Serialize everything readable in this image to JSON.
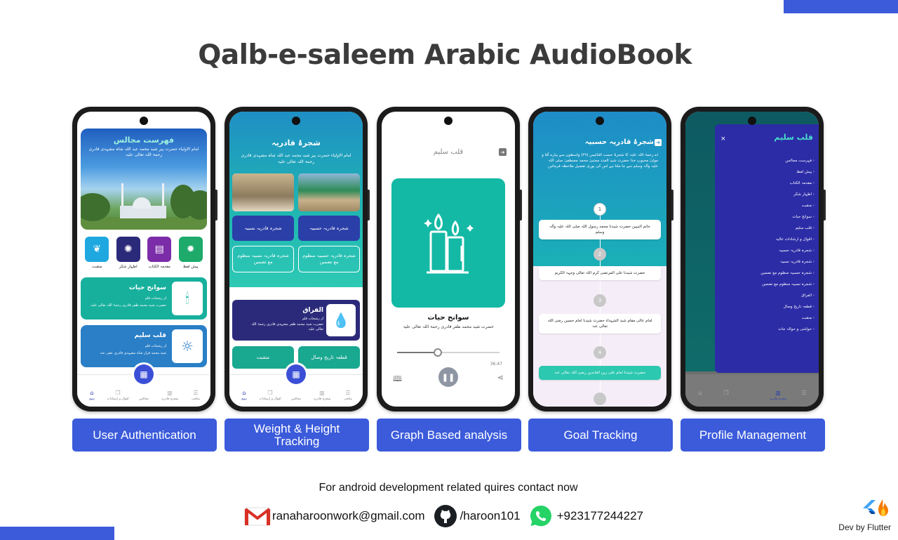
{
  "headline": "Qalb-e-saleem Arabic AudioBook",
  "colors": {
    "accent": "#3b5bdb",
    "teal": "#19a890",
    "navy": "#2b2a7a"
  },
  "features": [
    "User Authentication",
    "Weight & Height Tracking",
    "Graph Based analysis",
    "Goal Tracking",
    "Profile Management"
  ],
  "screen1": {
    "hero_title": "فهرست مجالس",
    "hero_sub": "امام الاولیاء حضرت پیر شید محمد عبد اللہ شاہ مشہدی قادری رحمۃ اللہ تعالی علیہ",
    "icons": [
      "منقبت",
      "اظہار شکر",
      "مقدمہ الکتاب",
      "پیش لفظ"
    ],
    "card1": {
      "title": "سوانح حیات",
      "line1": "از رشحات قلم",
      "line2": "حضرت شید محمد ظفر قادری رحمۃ اللہ تعالی علیہ"
    },
    "card2": {
      "title": "قلب سلیم",
      "line1": "از رشحات قلم",
      "line2": "شید محمد فراز شاہ مشہدی قادری عفی عنہ"
    },
    "nav": [
      "ہوم",
      "اقوال و ارشادات",
      "مجالس",
      "شجرہ قادریہ",
      "مناقب"
    ]
  },
  "screen2": {
    "title": "شجرۂ قادریہ",
    "sub": "امام الاولیاء حضرت پیر شید محمد عبد اللہ شاہ مشہدی قادری رحمۃ اللہ تعالی علیہ",
    "buttons": [
      "شجرہ قادریہ نسبیہ",
      "شجرہ قادریہ حسبیہ",
      "شجرہ قادریہ نسبیہ منظوم مع تضمین",
      "شجرہ قادریہ حسبیہ منظوم مع تضمین"
    ],
    "card": {
      "title": "الفراق",
      "line1": "از رشحات قلم",
      "line2": "حضرت شید محمد ظفر مشہدی قادری رحمۃ اللہ تعالی علیہ"
    },
    "teal": [
      "منقبت",
      "قطعہ تاریخ وصال"
    ],
    "nav": [
      "ہوم",
      "اقوال و ارشادات",
      "مجالس",
      "شجرہ قادریہ",
      "مناقب"
    ]
  },
  "screen3": {
    "top_title": "قلب سلیم",
    "name": "سوانح حیات",
    "desc": "حضرت شید محمد ظفر قادری رحمۃ اللہ تعالی علیہ",
    "time": "36:47",
    "progress": 0.4
  },
  "screen4": {
    "title": "شجرۂ قادریہ حسبیہ",
    "text": "اے رحمۃ اللہ علیہ کا شجرۂ حسب اقتائیس (۲۹) واسطوں سے پیارے آقا و مولیٰ محبوبِ خدا حضرت شید المدد مجتبیٰ محمد مصطفیٰ صلی اللہ علیہ وآلہ وسلم سے جا ملتا ہے اس کی یوری تفصیل ملاحظہ فرمائیں",
    "steps": [
      {
        "n": "1",
        "text": "خاتم النبیین حضرت شیدنا محمد رسول اللہ صلی اللہ علیہ وآلہ وسلم"
      },
      {
        "n": "2",
        "text": "حضرت شیدنا علی المرتضی کرم اللہ تعالی وجہہ الکریم"
      },
      {
        "n": "3",
        "text": "امام عالی مقام شید الشہداء حضرت شیدنا امام حسین رضی اللہ تعالی عنہ"
      },
      {
        "n": "4",
        "text": "حضرت شیدنا امام علی زین العابدین رضی اللہ تعالی عنہ"
      }
    ]
  },
  "screen5": {
    "drawer_title": "قلب سلیم",
    "close": "×",
    "items": [
      "فہرست مجالس",
      "پیش لفظ",
      "مقدمہ الکتاب",
      "اظہار شکر",
      "منقبت",
      "سوانح حیات",
      "قلب سلیم",
      "اقوال و ارشادات عالیہ",
      "شجرہ قادریہ حسبیہ",
      "شجرہ قادریہ نسبیہ",
      "شجرہ حسبیہ منظوم مع تضمین",
      "شجرہ نسبیہ منظوم مع تضمین",
      "الفراق",
      "قطعہ تاریخ وصال",
      "منقبت",
      "حواشی و حوالہ جات"
    ],
    "nav": [
      "ہوم",
      "اقوال و ارشادات",
      "مجالس",
      "شجرہ قادریہ",
      "مناقب"
    ]
  },
  "contact": {
    "line": "For android development related quires contact now",
    "email": "ranaharoonwork@gmail.com",
    "github": "/haroon101",
    "phone": "+923177244227"
  },
  "footer": {
    "devby": "Dev by Flutter"
  }
}
